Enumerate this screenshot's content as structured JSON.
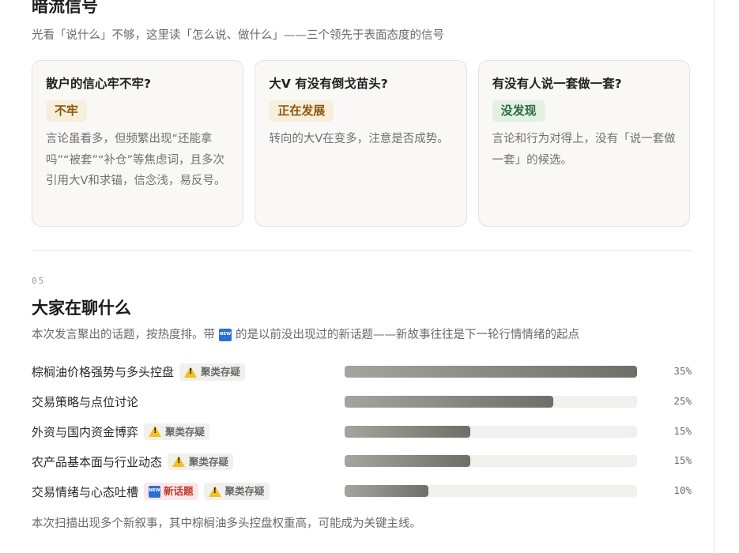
{
  "signals": {
    "title": "暗流信号",
    "subtitle": "光看「说什么」不够，这里读「怎么说、做什么」——三个领先于表面态度的信号",
    "cards": [
      {
        "question": "散户的信心牢不牢?",
        "badge": "不牢",
        "badge_type": "warn",
        "desc": "言论虽看多，但频繁出现“还能拿吗”“被套”“补仓”等焦虑词，且多次引用大V和求锚，信念浅，易反号。"
      },
      {
        "question": "大V 有没有倒戈苗头?",
        "badge": "正在发展",
        "badge_type": "warn",
        "desc": "转向的大V在变多，注意是否成势。"
      },
      {
        "question": "有没有人说一套做一套?",
        "badge": "没发现",
        "badge_type": "ok",
        "desc": "言论和行为对得上，没有「说一套做一套」的候选。"
      }
    ]
  },
  "topics": {
    "section_number": "05",
    "title": "大家在聊什么",
    "subtitle_before": "本次发言聚出的话题，按热度排。带",
    "subtitle_icon": "NEW",
    "subtitle_after": "的是以前没出现过的新话题——新故事往往是下一轮行情情绪的起点",
    "tag_doubt_label": "聚类存疑",
    "tag_new_label": "新话题",
    "items": [
      {
        "label": "棕榈油价格强势与多头控盘",
        "percent": 35,
        "percent_label": "35%",
        "is_new": false,
        "doubt": true
      },
      {
        "label": "交易策略与点位讨论",
        "percent": 25,
        "percent_label": "25%",
        "is_new": false,
        "doubt": false
      },
      {
        "label": "外资与国内资金博弈",
        "percent": 15,
        "percent_label": "15%",
        "is_new": false,
        "doubt": true
      },
      {
        "label": "农产品基本面与行业动态",
        "percent": 15,
        "percent_label": "15%",
        "is_new": false,
        "doubt": true
      },
      {
        "label": "交易情绪与心态吐槽",
        "percent": 10,
        "percent_label": "10%",
        "is_new": true,
        "doubt": true
      }
    ],
    "summary": "本次扫描出现多个新叙事，其中棕榈油多头控盘权重高，可能成为关键主线。"
  },
  "colors": {
    "warn_badge_bg": "#f7eedb",
    "ok_badge_bg": "#e3f0e6",
    "new_tag": "#c0392b",
    "bar_dark": "#6f6e68"
  }
}
